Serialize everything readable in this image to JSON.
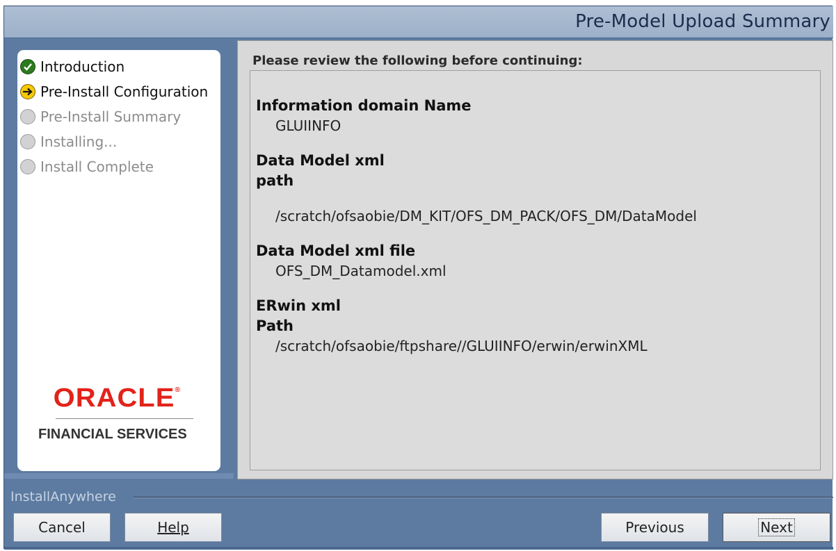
{
  "header": {
    "title": "Pre-Model Upload Summary"
  },
  "sidebar": {
    "steps": [
      {
        "label": "Introduction",
        "state": "done"
      },
      {
        "label": "Pre-Install Configuration",
        "state": "current"
      },
      {
        "label": "Pre-Install Summary",
        "state": "pending"
      },
      {
        "label": "Installing...",
        "state": "pending"
      },
      {
        "label": "Install Complete",
        "state": "pending"
      }
    ],
    "logo_text": "ORACLE",
    "logo_subtext": "FINANCIAL SERVICES"
  },
  "main": {
    "instruction": "Please review the following before continuing:",
    "items": [
      {
        "heading": "Information domain Name",
        "value": "GLUIINFO"
      },
      {
        "heading_line1": "Data Model xml",
        "heading_line2": "path",
        "value": "/scratch/ofsaobie/DM_KIT/OFS_DM_PACK/OFS_DM/DataModel"
      },
      {
        "heading": "Data Model xml file",
        "value": "OFS_DM_Datamodel.xml"
      },
      {
        "heading_line1": "ERwin xml",
        "heading_line2": "Path",
        "value": "/scratch/ofsaobie/ftpshare//GLUIINFO/erwin/erwinXML"
      }
    ]
  },
  "footer": {
    "brand": "InstallAnywhere",
    "cancel_label": "Cancel",
    "help_label": "Help",
    "previous_label": "Previous",
    "next_label": "Next"
  },
  "colors": {
    "header_bg": "#9cb0c9",
    "window_bg": "#5d7ba0",
    "oracle_red": "#e2231a",
    "done_icon": "#2c7a1d",
    "current_icon": "#f7c806"
  },
  "icons": {
    "done": "checkmark-icon",
    "current": "arrow-right-icon",
    "pending": "empty-circle-icon"
  }
}
